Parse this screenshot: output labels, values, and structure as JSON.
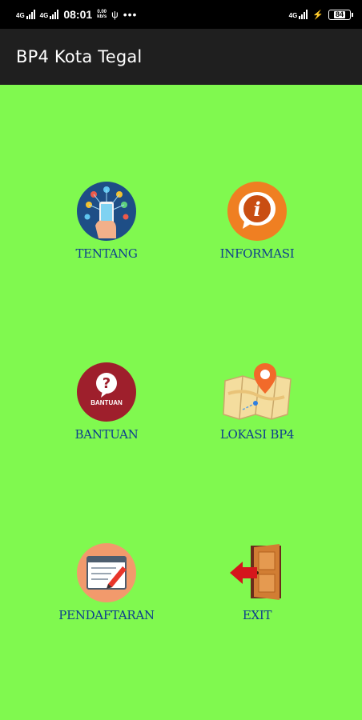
{
  "status_bar": {
    "signal_1": "4G",
    "signal_2": "4G",
    "time": "08:01",
    "net_speed_value": "0.00",
    "net_speed_unit": "kb/s",
    "right_network": "4G",
    "battery": "84"
  },
  "app_bar": {
    "title": "BP4 Kota Tegal"
  },
  "menu": {
    "tentang": "TENTANG",
    "informasi": "INFORMASI",
    "bantuan": "BANTUAN",
    "bantuan_icon_text": "BANTUAN",
    "lokasi": "LOKASI BP4",
    "pendaftaran": "PENDAFTARAN",
    "exit": "EXIT"
  },
  "colors": {
    "background": "#80f94f",
    "label": "#0e3e8e",
    "app_bar": "#1f1f1f"
  }
}
